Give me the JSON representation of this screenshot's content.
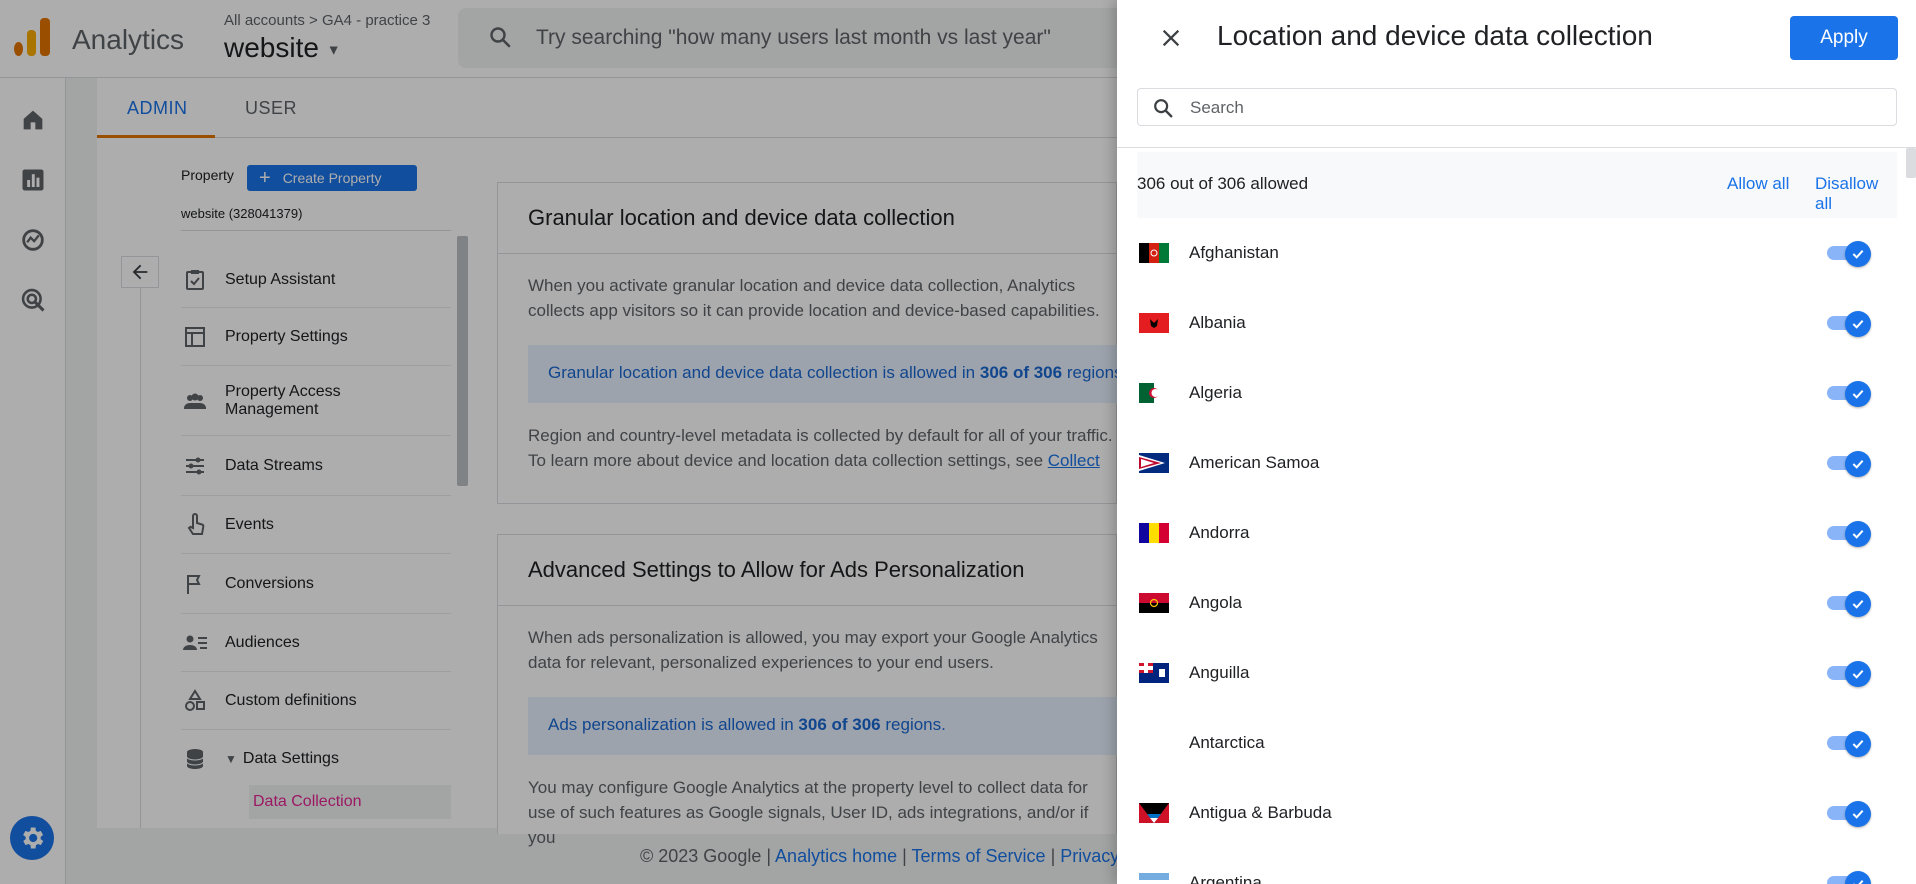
{
  "topbar": {
    "app_name": "Analytics",
    "breadcrumb": "All accounts > GA4 - practice 3",
    "property": "website",
    "search_placeholder": "Try searching \"how many users last month vs last year\""
  },
  "tabs": [
    {
      "label": "ADMIN",
      "active": true
    },
    {
      "label": "USER",
      "active": false
    }
  ],
  "nav": {
    "property_label": "Property",
    "create_label": "Create Property",
    "property_id": "website (328041379)",
    "items": [
      {
        "label": "Setup Assistant",
        "icon": "checklist-icon"
      },
      {
        "label": "Property Settings",
        "icon": "layout-icon"
      },
      {
        "label": "Property Access Management",
        "icon": "people-icon"
      },
      {
        "label": "Data Streams",
        "icon": "streams-icon"
      },
      {
        "label": "Events",
        "icon": "touch-icon"
      },
      {
        "label": "Conversions",
        "icon": "flag-icon"
      },
      {
        "label": "Audiences",
        "icon": "audience-icon"
      },
      {
        "label": "Custom definitions",
        "icon": "shapes-icon"
      },
      {
        "label": "Data Settings",
        "icon": "database-icon"
      }
    ],
    "sub_item": "Data Collection"
  },
  "cards": {
    "granular": {
      "title": "Granular location and device data collection",
      "body": "When you activate granular location and device data collection, Analytics collects app visitors so it can provide location and device-based capabilities.",
      "banner_pre": "Granular location and device data collection is allowed in ",
      "banner_bold": "306 of 306",
      "banner_post": " regions.",
      "footnote_pre": "Region and country-level metadata is collected by default for all of your traffic. To learn more about device and location data collection settings, see ",
      "footnote_link": "Collect"
    },
    "ads": {
      "title": "Advanced Settings to Allow for Ads Personalization",
      "body": "When ads personalization is allowed, you may export your Google Analytics data for relevant, personalized experiences to your end users.",
      "banner_pre": "Ads personalization is allowed in ",
      "banner_bold": "306 of 306",
      "banner_post": " regions.",
      "footnote": "You may configure Google Analytics at the property level to collect data for use of such features as Google signals, User ID, ads integrations, and/or if you"
    }
  },
  "footer": {
    "copyright": "© 2023 Google |",
    "home": "Analytics home",
    "sep1": "|",
    "terms": "Terms of Service",
    "sep2": "|",
    "privacy": "Privacy"
  },
  "drawer": {
    "title": "Location and device data collection",
    "apply_label": "Apply",
    "search_placeholder": "Search",
    "count": "306 out of 306 allowed",
    "allow_all": "Allow all",
    "disallow_all": "Disallow all",
    "countries": [
      {
        "name": "Afghanistan",
        "allowed": true
      },
      {
        "name": "Albania",
        "allowed": true
      },
      {
        "name": "Algeria",
        "allowed": true
      },
      {
        "name": "American Samoa",
        "allowed": true
      },
      {
        "name": "Andorra",
        "allowed": true
      },
      {
        "name": "Angola",
        "allowed": true
      },
      {
        "name": "Anguilla",
        "allowed": true
      },
      {
        "name": "Antarctica",
        "allowed": true
      },
      {
        "name": "Antigua & Barbuda",
        "allowed": true
      },
      {
        "name": "Argentina",
        "allowed": true
      }
    ]
  },
  "colors": {
    "accent": "#1a73e8",
    "brand_orange": "#e37400",
    "active_sub": "#e52592"
  }
}
